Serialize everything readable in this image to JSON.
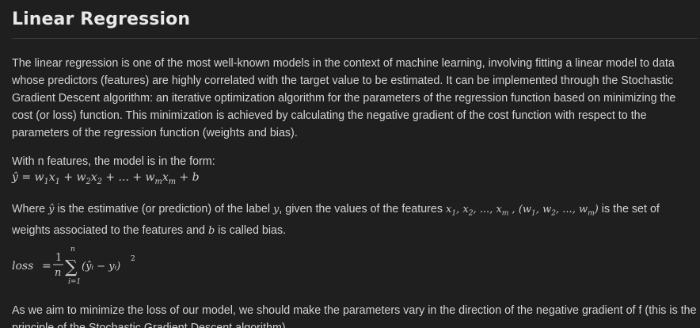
{
  "title": "Linear Regression",
  "paragraph1": "The linear regression is one of the most well-known models in the context of machine learning, involving fitting a linear model to data whose predictors (features) are highly correlated with the target value to be estimated. It can be implemented through the Stochastic Gradient Descent algorithm: an iterative optimization algorithm for the parameters of the regression function based on minimizing the cost (or loss) function. This minimization is achieved by calculating the negative gradient of the cost function with respect to the parameters of the regression function (weights and bias).",
  "paragraph2": "With n features, the model is in the form:",
  "paragraph3": {
    "t1": "Where ",
    "t2": " is the estimative (or prediction) of the label ",
    "t3": ", given the values of the features ",
    "t4": " is the set of weights associated to the features and ",
    "t5": " is called bias."
  },
  "paragraph4": "As we aim to minimize the loss of our model, we should make the parameters vary in the direction of the negative gradient of f (this is the principle of the Stochastic Gradient Descent algorithm).",
  "math": {
    "loss_label": "loss",
    "eq": "=",
    "one": "1",
    "n": "n",
    "sum_top": "n",
    "sum_sign": "∑",
    "sum_bottom": "i=1",
    "sum_body": "(ŷᵢ − yᵢ)",
    "power": "2"
  }
}
